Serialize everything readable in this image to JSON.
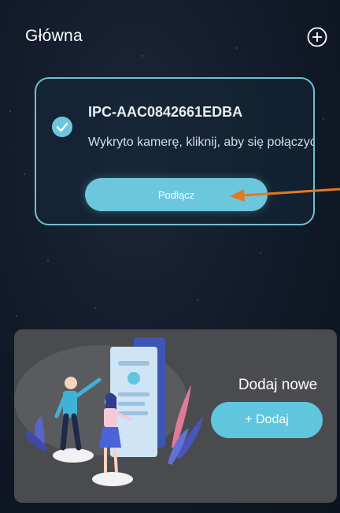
{
  "header": {
    "title": "Główna",
    "add_icon": "plus-circle-icon"
  },
  "device_card": {
    "name": "IPC-AAC0842661EDBA",
    "hint": "Wykryto kamerę, kliknij, aby się połączyć",
    "check_icon": "check-circle-icon",
    "connect_label": "Podłącz"
  },
  "add_panel": {
    "title": "Dodaj nowe",
    "button_label": "+ Dodaj"
  },
  "colors": {
    "accent": "#6cc7dd",
    "card_border": "#6fc0d4",
    "annotation_arrow": "#e07a1f",
    "panel_bg": "#4a4b4e"
  }
}
